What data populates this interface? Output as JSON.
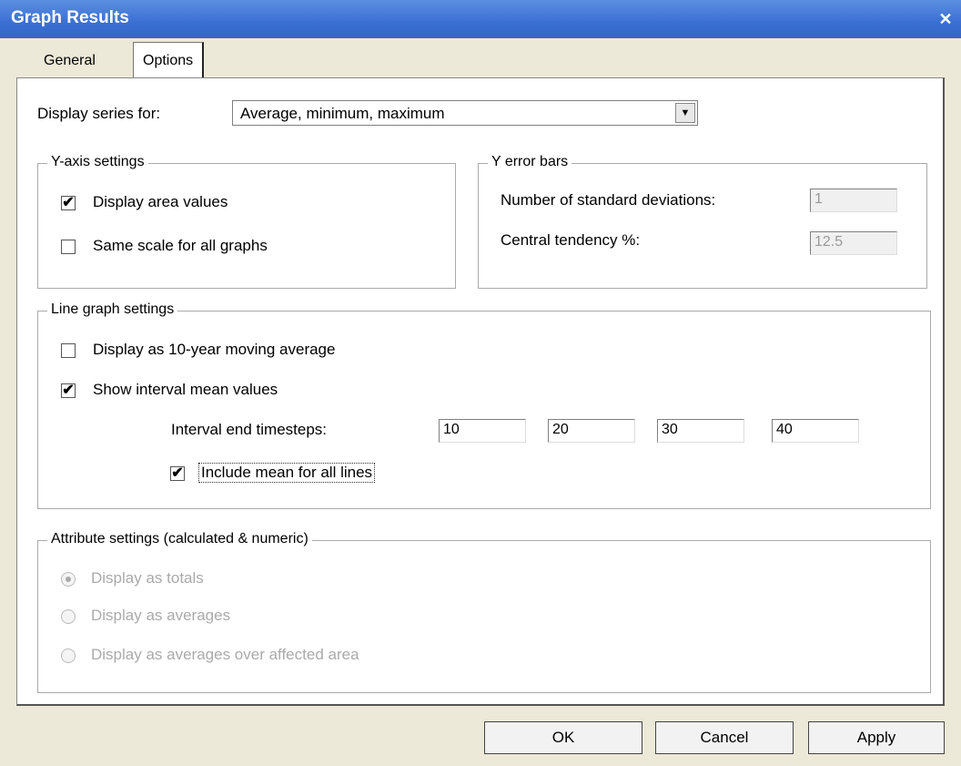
{
  "window": {
    "title": "Graph Results",
    "close_glyph": "✕"
  },
  "tabs": [
    {
      "label": "General"
    },
    {
      "label": "Options"
    }
  ],
  "display_series": {
    "label": "Display series for:",
    "selected": "Average, minimum, maximum",
    "arrow_glyph": "▼"
  },
  "y_axis": {
    "legend": "Y-axis settings",
    "display_area_values": {
      "label": "Display area values",
      "checked": "✔"
    },
    "same_scale": {
      "label": "Same scale for all graphs",
      "checked": ""
    }
  },
  "y_error_bars": {
    "legend": "Y error bars",
    "std_dev": {
      "label": "Number of standard deviations:",
      "value": "1"
    },
    "central_tendency": {
      "label": "Central tendency %:",
      "value": "12.5"
    }
  },
  "line_graph": {
    "legend": "Line graph settings",
    "moving_average": {
      "label": "Display as 10-year moving average",
      "checked": ""
    },
    "interval_mean": {
      "label": "Show interval mean values",
      "checked": "✔"
    },
    "interval_end_label": "Interval end timesteps:",
    "interval_values": [
      "10",
      "20",
      "30",
      "40"
    ],
    "include_mean": {
      "label": "Include mean for all lines",
      "checked": "✔"
    }
  },
  "attribute": {
    "legend": "Attribute settings (calculated & numeric)",
    "options": [
      {
        "label": "Display as totals",
        "selected": true
      },
      {
        "label": "Display as averages",
        "selected": false
      },
      {
        "label": "Display as averages over affected area",
        "selected": false
      }
    ]
  },
  "buttons": {
    "ok": "OK",
    "cancel": "Cancel",
    "apply": "Apply"
  }
}
